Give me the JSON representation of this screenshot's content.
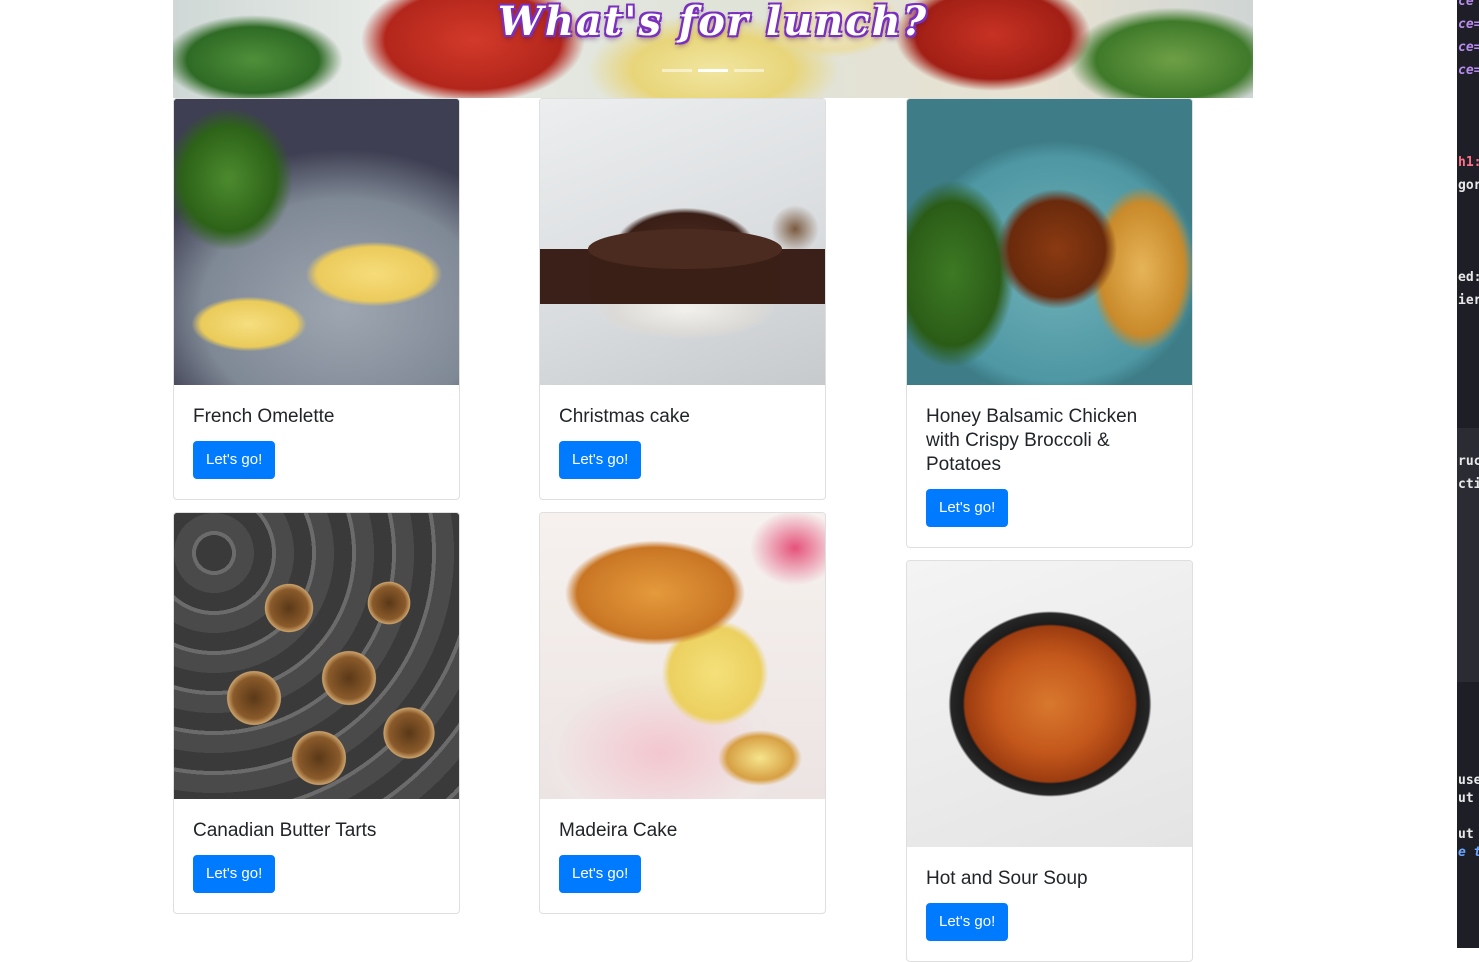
{
  "hero": {
    "title": "What's for lunch?",
    "indicators": [
      false,
      true,
      false
    ]
  },
  "cards": [
    {
      "title": "French Omelette",
      "button": "Let's go!",
      "image": "french-omelette-photo"
    },
    {
      "title": "Christmas cake",
      "button": "Let's go!",
      "image": "christmas-cake-photo"
    },
    {
      "title": "Honey Balsamic Chicken with Crispy Broccoli & Potatoes",
      "button": "Let's go!",
      "image": "honey-balsamic-chicken-photo"
    },
    {
      "title": "Canadian Butter Tarts",
      "button": "Let's go!",
      "image": "canadian-butter-tarts-photo"
    },
    {
      "title": "Madeira Cake",
      "button": "Let's go!",
      "image": "madeira-cake-photo"
    },
    {
      "title": "Hot and Sour Soup",
      "button": "Let's go!",
      "image": "hot-and-sour-soup-photo"
    }
  ],
  "code_fragments": [
    "ce",
    "ce=",
    "ce=",
    "ce=",
    "h1:",
    "gor",
    "ed:",
    "ier",
    "ruc",
    "cti",
    "use",
    "ut",
    "ut",
    "e t"
  ],
  "colors": {
    "primary_button": "#007bff",
    "hero_title_outline": "#7b2fbf"
  }
}
